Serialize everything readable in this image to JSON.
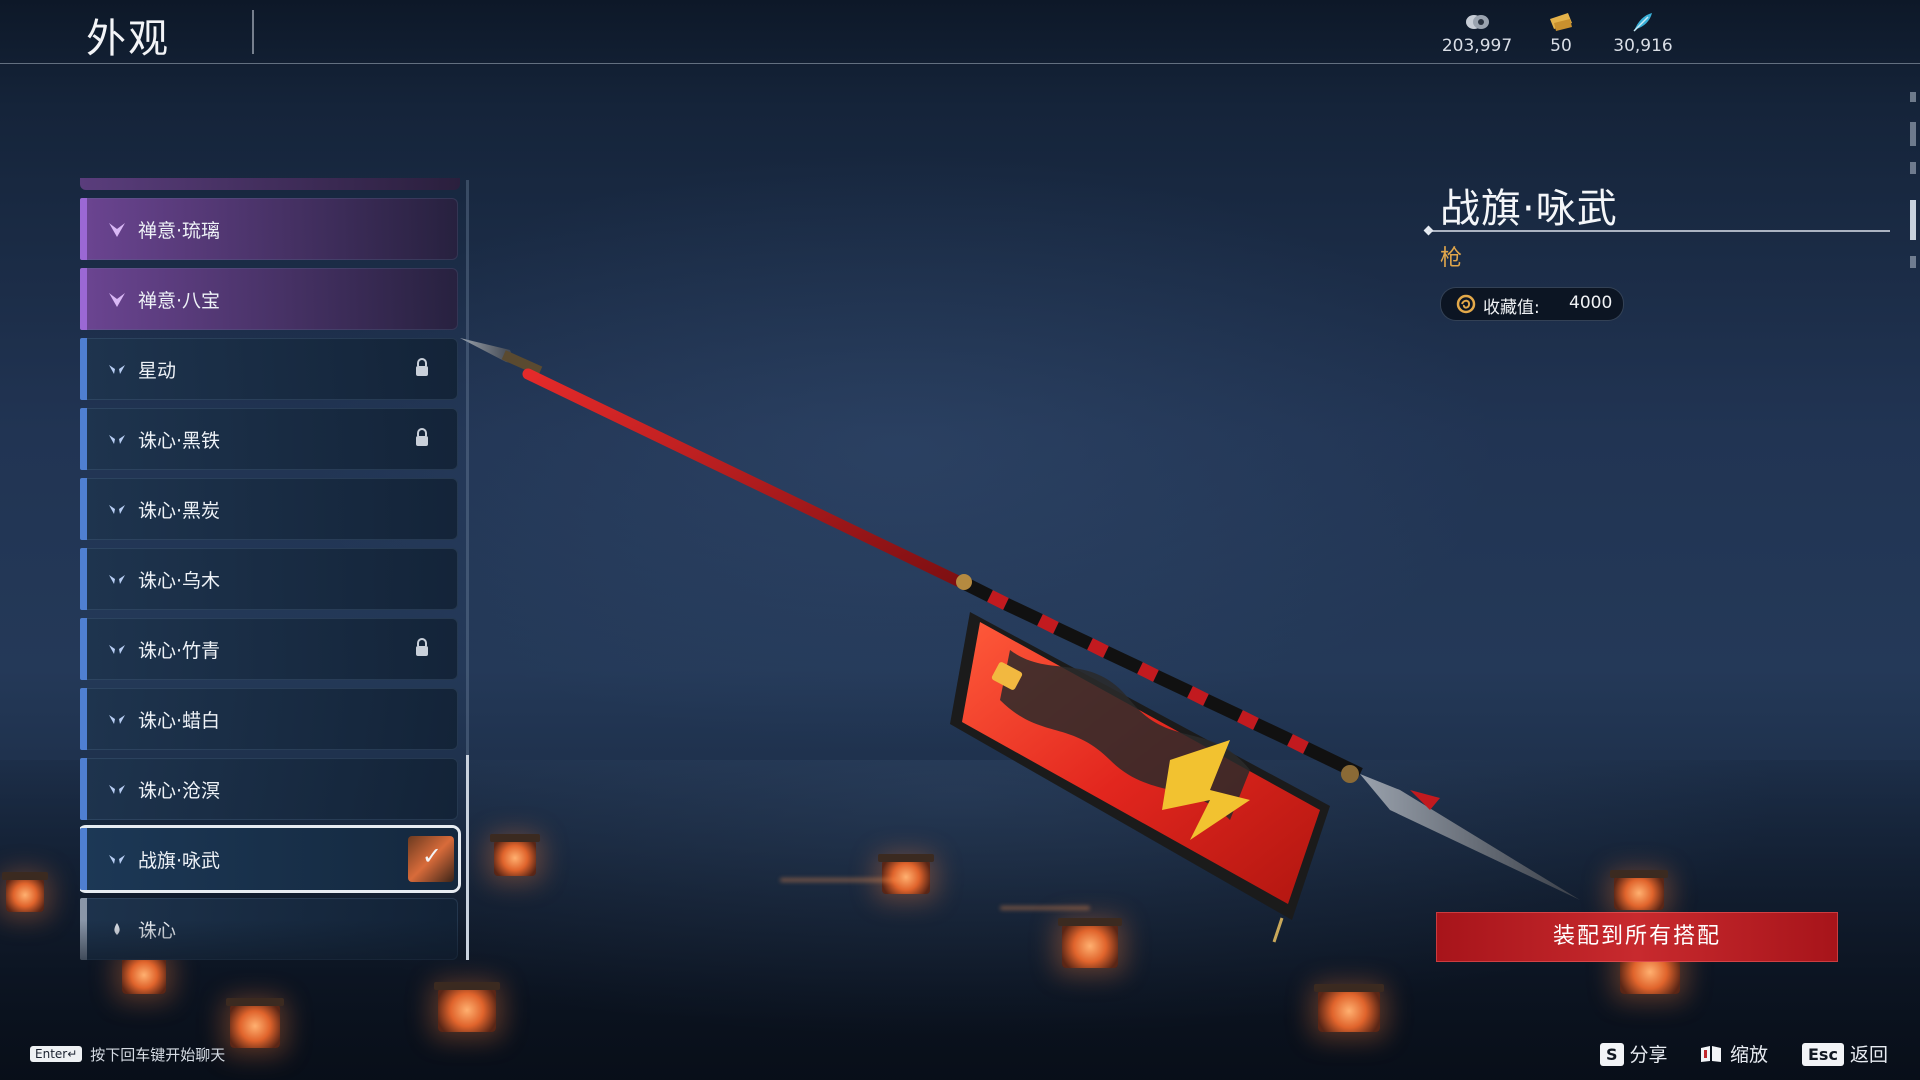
{
  "header": {
    "title": "外观",
    "currencies": [
      {
        "icon": "coin-icon",
        "value": "203,997"
      },
      {
        "icon": "ticket-icon",
        "value": "50"
      },
      {
        "icon": "feather-icon",
        "value": "30,916"
      }
    ]
  },
  "list": {
    "items": [
      {
        "label": "禅意·琉璃",
        "rarity": "purple",
        "locked": false
      },
      {
        "label": "禅意·八宝",
        "rarity": "purple",
        "locked": false
      },
      {
        "label": "星动",
        "rarity": "blue",
        "locked": true
      },
      {
        "label": "诛心·黑铁",
        "rarity": "blue",
        "locked": true
      },
      {
        "label": "诛心·黑炭",
        "rarity": "blue",
        "locked": false
      },
      {
        "label": "诛心·乌木",
        "rarity": "blue",
        "locked": false
      },
      {
        "label": "诛心·竹青",
        "rarity": "blue",
        "locked": true
      },
      {
        "label": "诛心·蜡白",
        "rarity": "blue",
        "locked": false
      },
      {
        "label": "诛心·沧溟",
        "rarity": "blue",
        "locked": false
      },
      {
        "label": "战旗·咏武",
        "rarity": "blue",
        "locked": false,
        "selected": true,
        "equipped": true
      },
      {
        "label": "诛心",
        "rarity": "grey",
        "locked": false
      }
    ]
  },
  "detail": {
    "name": "战旗·咏武",
    "type": "枪",
    "collection_label": "收藏值:",
    "collection_value": "4000",
    "equip_button": "装配到所有搭配"
  },
  "footer": {
    "chat_key": "Enter↵",
    "chat_hint": "按下回车键开始聊天",
    "actions": [
      {
        "key": "S",
        "label": "分享"
      },
      {
        "key": "",
        "label": "缩放",
        "icon": "book-icon"
      },
      {
        "key": "Esc",
        "label": "返回"
      }
    ]
  },
  "colors": {
    "accent_red": "#c0272c",
    "rarity_purple": "#9b68d4",
    "rarity_blue": "#4f7fd1",
    "type_gold": "#e0a64b"
  }
}
